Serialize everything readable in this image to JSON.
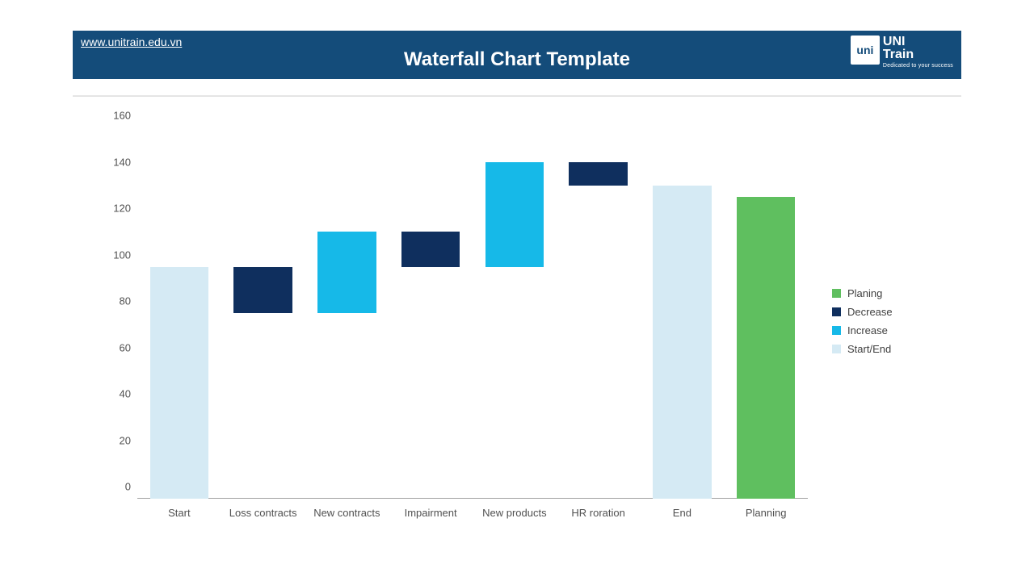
{
  "header": {
    "url": "www.unitrain.edu.vn",
    "title": "Waterfall Chart Template",
    "logo_box": "uni",
    "logo_l1": "UNI",
    "logo_l2": "Train",
    "logo_tag": "Dedicated to your success"
  },
  "legend": {
    "items": [
      {
        "label": "Planing",
        "color": "#5fbf5f"
      },
      {
        "label": "Decrease",
        "color": "#0f2f5e"
      },
      {
        "label": "Increase",
        "color": "#16b9e8"
      },
      {
        "label": "Start/End",
        "color": "#d5eaf4"
      }
    ]
  },
  "chart_data": {
    "type": "waterfall",
    "title": "Waterfall Chart Template",
    "xlabel": "",
    "ylabel": "",
    "ylim": [
      0,
      160
    ],
    "yticks": [
      0,
      20,
      40,
      60,
      80,
      100,
      120,
      140,
      160
    ],
    "categories": [
      "Start",
      "Loss contracts",
      "New contracts",
      "Impairment",
      "New products",
      "HR roration",
      "End",
      "Planning"
    ],
    "bars": [
      {
        "label": "Start",
        "kind": "start_end",
        "bottom": 0,
        "top": 100,
        "delta": 100
      },
      {
        "label": "Loss contracts",
        "kind": "decrease",
        "bottom": 80,
        "top": 100,
        "delta": -20
      },
      {
        "label": "New contracts",
        "kind": "increase",
        "bottom": 80,
        "top": 115,
        "delta": 35
      },
      {
        "label": "Impairment",
        "kind": "decrease",
        "bottom": 100,
        "top": 115,
        "delta": -15
      },
      {
        "label": "New products",
        "kind": "increase",
        "bottom": 100,
        "top": 145,
        "delta": 45
      },
      {
        "label": "HR roration",
        "kind": "decrease",
        "bottom": 135,
        "top": 145,
        "delta": -10
      },
      {
        "label": "End",
        "kind": "start_end",
        "bottom": 0,
        "top": 135,
        "delta": 135
      },
      {
        "label": "Planning",
        "kind": "planning",
        "bottom": 0,
        "top": 130,
        "delta": 130
      }
    ],
    "colors": {
      "planning": "#5fbf5f",
      "decrease": "#0f2f5e",
      "increase": "#16b9e8",
      "start_end": "#d5eaf4"
    },
    "legend_position": "right",
    "grid": false
  }
}
